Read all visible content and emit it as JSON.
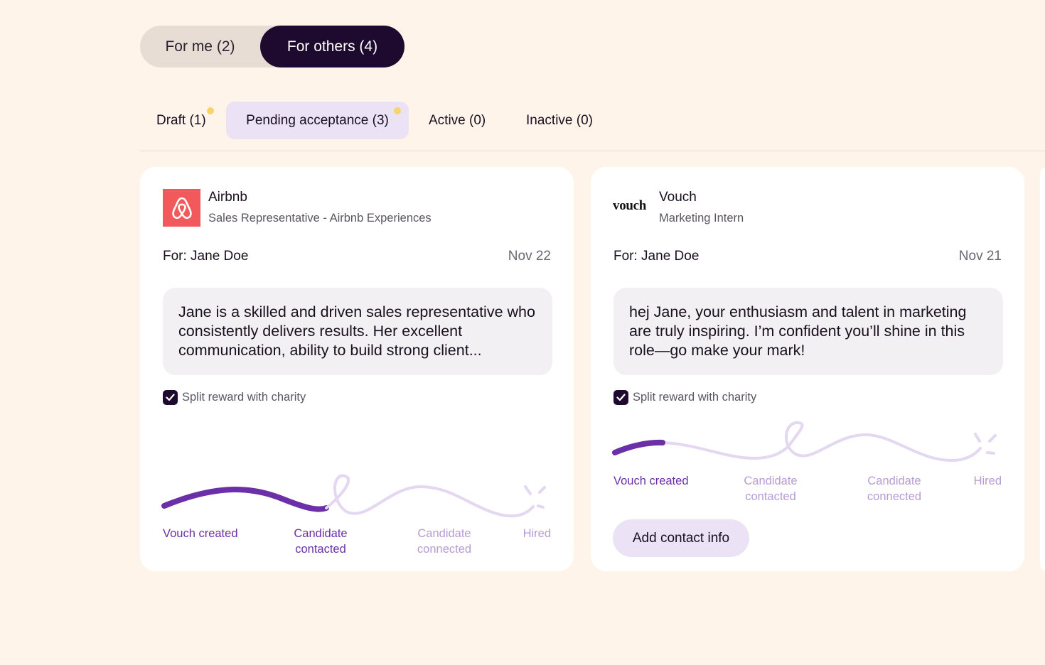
{
  "segments": {
    "for_me": "For me (2)",
    "for_others": "For others (4)"
  },
  "tabs": [
    {
      "label": "Draft (1)"
    },
    {
      "label": "Pending acceptance (3)"
    },
    {
      "label": "Active (0)"
    },
    {
      "label": "Inactive (0)"
    }
  ],
  "cards": [
    {
      "company": "Airbnb",
      "role": "Sales Representative - Airbnb Experiences",
      "for": "For: Jane Doe",
      "date": "Nov 22",
      "message": "Jane is a skilled and driven sales representative who consistently delivers results. Her excellent communication, ability to build strong client...",
      "charity_label": "Split reward with charity",
      "charity_checked": true,
      "stages": [
        {
          "line1": "Vouch created",
          "line2": ""
        },
        {
          "line1": "Candidate",
          "line2": "contacted"
        },
        {
          "line1": "Candidate",
          "line2": "connected"
        },
        {
          "line1": "Hired",
          "line2": ""
        }
      ],
      "stages_completed": 2
    },
    {
      "company": "Vouch",
      "logo_text": "vouch",
      "role": "Marketing Intern",
      "for": "For: Jane Doe",
      "date": "Nov 21",
      "message": "hej Jane, your enthusiasm and talent in marketing are truly inspiring. I’m confident you’ll shine in this role—go make your mark!",
      "charity_label": "Split reward with charity",
      "charity_checked": true,
      "stages": [
        {
          "line1": "Vouch created",
          "line2": ""
        },
        {
          "line1": "Candidate",
          "line2": "contacted"
        },
        {
          "line1": "Candidate",
          "line2": "connected"
        },
        {
          "line1": "Hired",
          "line2": ""
        }
      ],
      "stages_completed": 1,
      "action_label": "Add contact info"
    }
  ],
  "colors": {
    "background": "#fff4ea",
    "dark": "#1e0a2e",
    "accent_purple": "#6b2fa8",
    "track_light": "#e4d7f1",
    "tab_active_bg": "#ebe2f5",
    "notify_dot": "#f7d46a",
    "airbnb_red": "#f2595b"
  }
}
